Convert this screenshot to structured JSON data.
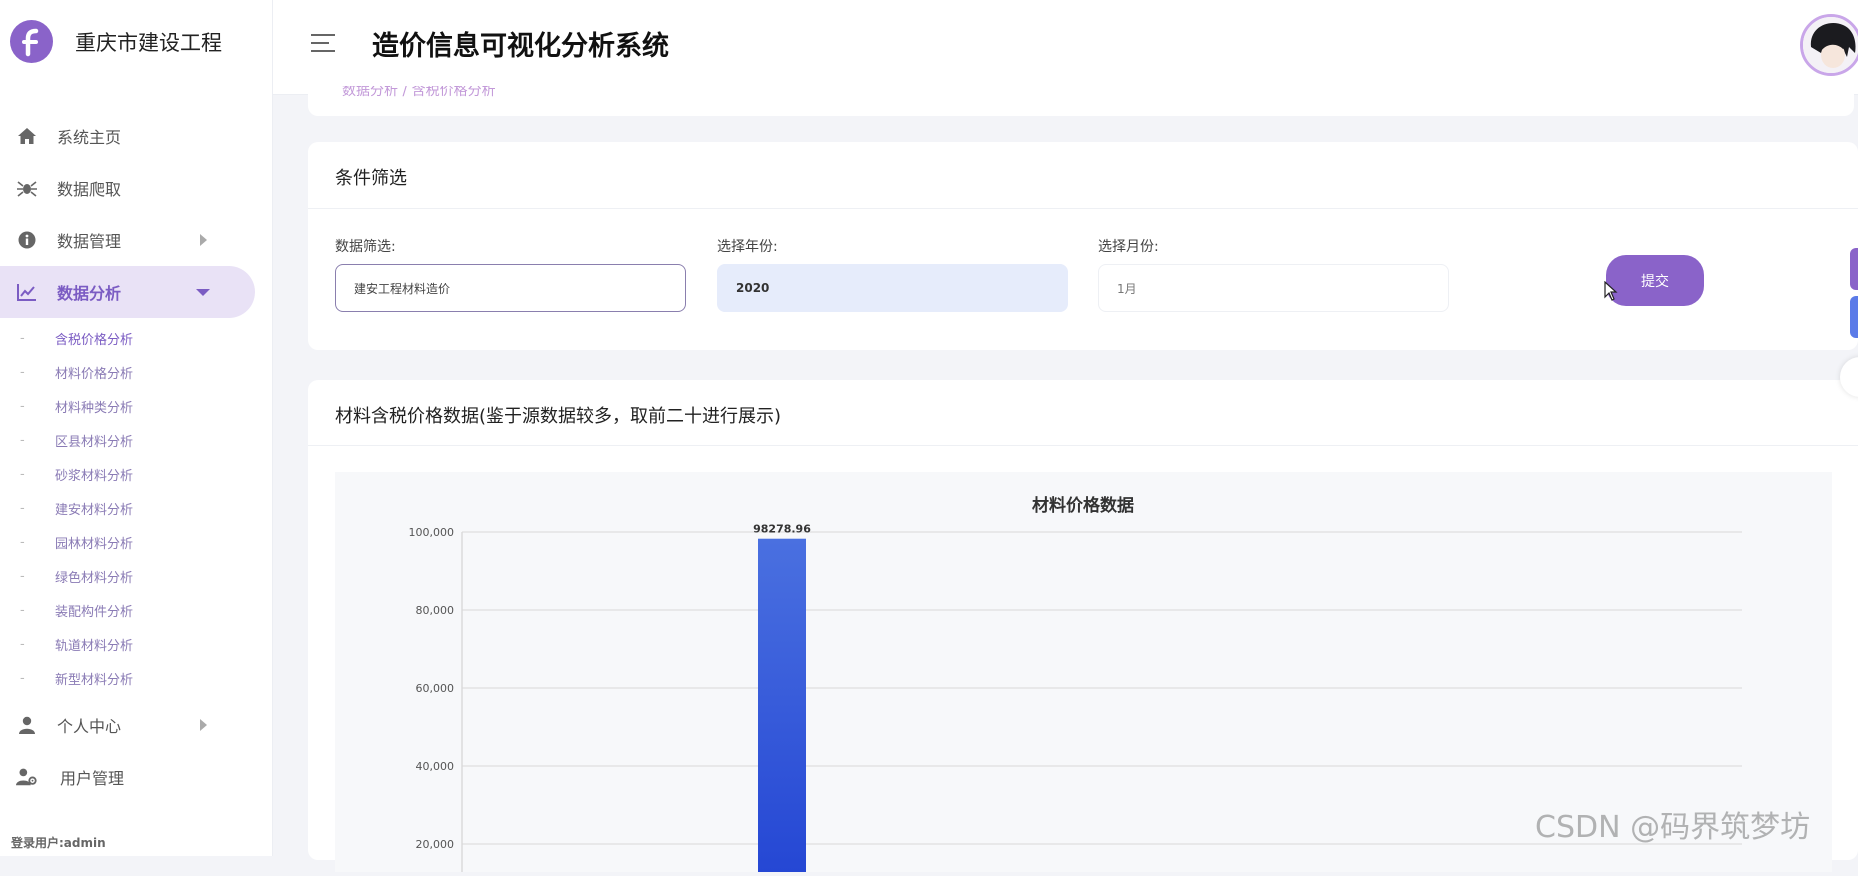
{
  "brand": {
    "name": "重庆市建设工程",
    "logo_letter": "f"
  },
  "header": {
    "title": "造价信息可视化分析系统"
  },
  "breadcrumb": {
    "text": "数据分析 / 含税价格分析"
  },
  "sidebar": {
    "items": [
      {
        "label": "系统主页",
        "icon": "home-icon"
      },
      {
        "label": "数据爬取",
        "icon": "spider-icon"
      },
      {
        "label": "数据管理",
        "icon": "info-icon"
      },
      {
        "label": "数据分析",
        "icon": "line-chart-icon"
      },
      {
        "label": "个人中心",
        "icon": "user-icon"
      },
      {
        "label": "用户管理",
        "icon": "user-gear-icon"
      }
    ],
    "subitems": [
      "含税价格分析",
      "材料价格分析",
      "材料种类分析",
      "区县材料分析",
      "砂浆材料分析",
      "建安材料分析",
      "园林材料分析",
      "绿色材料分析",
      "装配构件分析",
      "轨道材料分析",
      "新型材料分析"
    ],
    "login_user": "登录用户:admin"
  },
  "filter": {
    "title": "条件筛选",
    "data_label": "数据筛选:",
    "data_value": "建安工程材料造价",
    "year_label": "选择年份:",
    "year_value": "2020",
    "month_label": "选择月份:",
    "month_value": "1月",
    "submit_label": "提交"
  },
  "chart_section": {
    "title": "材料含税价格数据(鉴于源数据较多，取前二十进行展示)"
  },
  "chart_data": {
    "type": "bar",
    "title": "材料价格数据",
    "xlabel": "",
    "ylabel": "",
    "ylim": [
      0,
      100000
    ],
    "yticks": [
      "100,000",
      "80,000",
      "60,000",
      "40,000",
      "20,000"
    ],
    "ytick_values": [
      100000,
      80000,
      60000,
      40000,
      20000
    ],
    "values": [
      98278.96
    ],
    "value_labels": [
      "98278.96"
    ],
    "grid": true
  },
  "watermark": "CSDN @码界筑梦坊",
  "colors": {
    "accent": "#8a63c9",
    "bar_top": "#4a70e0",
    "bar_bottom": "#2a4fd6"
  }
}
